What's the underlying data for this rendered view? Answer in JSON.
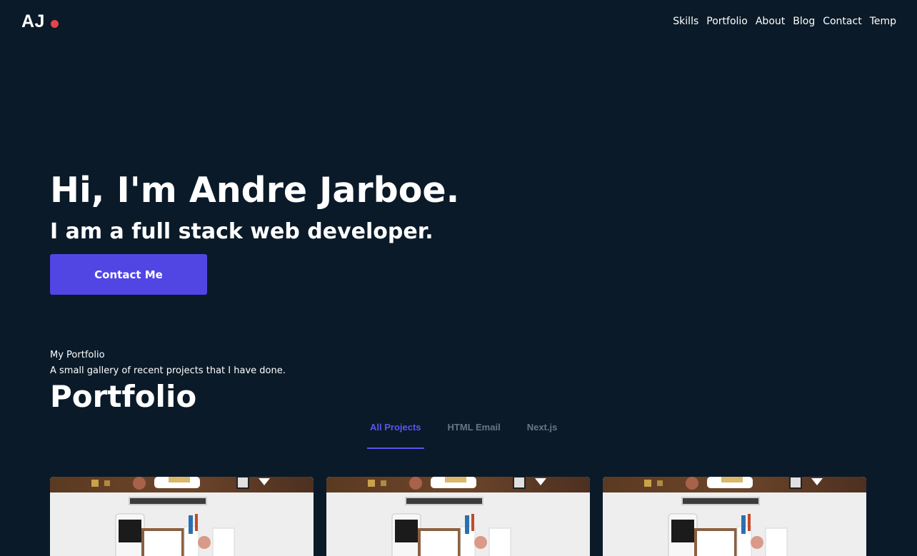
{
  "header": {
    "logo_text": "AJ",
    "logo_dot_color": "#e8434a",
    "nav": [
      "Skills",
      "Portfolio",
      "About",
      "Blog",
      "Contact",
      "Temp"
    ]
  },
  "hero": {
    "title": "Hi, I'm Andre Jarboe.",
    "subtitle": "I am a full stack web developer.",
    "cta_label": "Contact Me",
    "cta_color": "#5145e4"
  },
  "portfolio": {
    "eyebrow": "My Portfolio",
    "description": "A small gallery of recent projects that I have done.",
    "title": "Portfolio",
    "tabs": [
      {
        "label": "All Projects",
        "active": true
      },
      {
        "label": "HTML Email",
        "active": false
      },
      {
        "label": "Next.js",
        "active": false
      }
    ],
    "cards": [
      {
        "image": "desk-workspace-photo"
      },
      {
        "image": "desk-workspace-photo"
      },
      {
        "image": "desk-workspace-photo"
      }
    ]
  },
  "colors": {
    "background": "#0a1a28",
    "accent": "#5b55ef"
  }
}
